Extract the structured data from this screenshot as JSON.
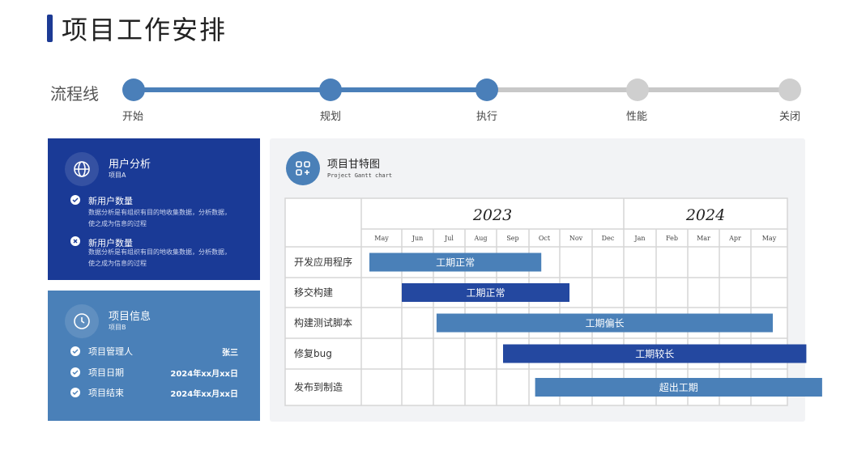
{
  "page": {
    "title": "项目工作安排"
  },
  "flow": {
    "label": "流程线",
    "steps": [
      "开始",
      "规划",
      "执行",
      "性能",
      "关闭"
    ]
  },
  "user_card": {
    "title": "用户分析",
    "subtitle": "项目A",
    "items": [
      {
        "icon": "check-icon",
        "title": "新用户数量",
        "desc_line1": "数据分析是有组织有目的地收集数据，分析数据，",
        "desc_line2": "使之成为信息的过程"
      },
      {
        "icon": "close-icon",
        "title": "新用户数量",
        "desc_line1": "数据分析是有组织有目的地收集数据，分析数据，",
        "desc_line2": "使之成为信息的过程"
      }
    ]
  },
  "info_card": {
    "title": "项目信息",
    "subtitle": "项目B",
    "rows": [
      {
        "label": "项目管理人",
        "value": "张三"
      },
      {
        "label": "项目日期",
        "value": "2024年xx月xx日"
      },
      {
        "label": "项目结束",
        "value": "2024年xx月xx日"
      }
    ]
  },
  "gantt": {
    "title": "项目甘特图",
    "subtitle": "Project Gantt chart",
    "years": [
      "2023",
      "2024"
    ],
    "months": [
      "May",
      "Jun",
      "Jul",
      "Aug",
      "Sep",
      "Oct",
      "Nov",
      "Dec",
      "Jan",
      "Feb",
      "Mar",
      "Apr",
      "May"
    ],
    "colors": {
      "light": "#4a80b8",
      "dark": "#2448a0"
    },
    "tasks": [
      {
        "name": "开发应用程序",
        "status": "工期正常",
        "start": 0.2,
        "end": 5.4,
        "color": "light"
      },
      {
        "name": "移交构建",
        "status": "工期正常",
        "start": 1.0,
        "end": 6.3,
        "color": "dark"
      },
      {
        "name": "构建测试脚本",
        "status": "工期偏长",
        "start": 2.1,
        "end": 12.6,
        "color": "light"
      },
      {
        "name": "修复bug",
        "status": "工期较长",
        "start": 4.2,
        "end": 13.6,
        "color": "dark"
      },
      {
        "name": "发布到制造",
        "status": "超出工期",
        "start": 5.2,
        "end": 14.1,
        "color": "light"
      }
    ]
  }
}
